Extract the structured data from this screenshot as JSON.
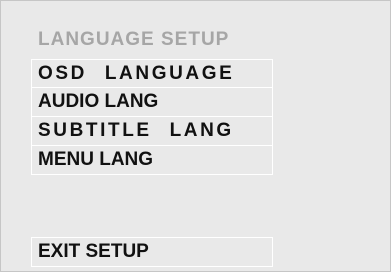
{
  "menu": {
    "title": "LANGUAGE SETUP",
    "items": [
      {
        "label": "OSD LANGUAGE"
      },
      {
        "label": "AUDIO LANG"
      },
      {
        "label": "SUBTITLE LANG"
      },
      {
        "label": "MENU LANG"
      }
    ],
    "exit_label": "EXIT SETUP"
  },
  "colors": {
    "background": "#e9e9e9",
    "title_text": "#a6a6a6",
    "item_text": "#111111",
    "item_border": "#ffffff"
  }
}
